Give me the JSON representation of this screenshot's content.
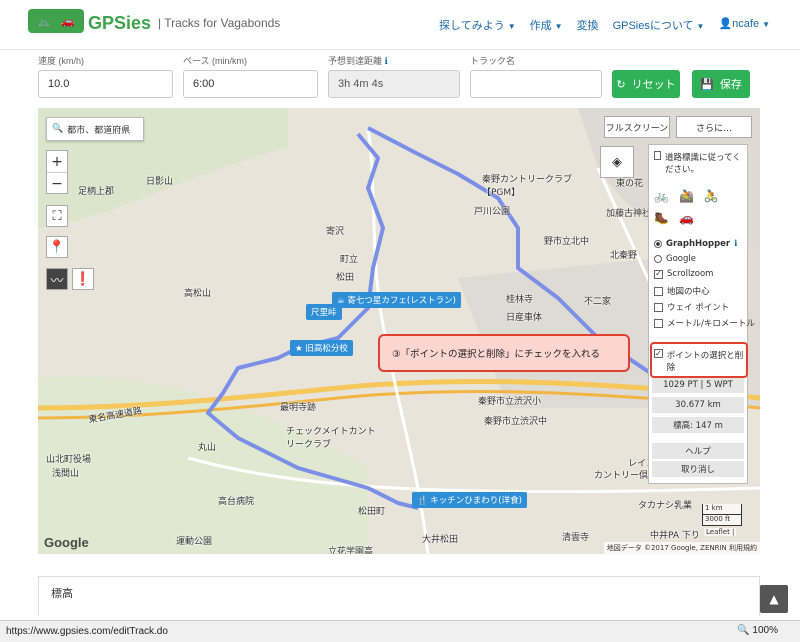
{
  "header": {
    "brand": "GPSies",
    "tagline": "| Tracks for Vagabonds",
    "menu": [
      "探してみよう",
      "作成",
      "変換",
      "GPSiesについて",
      "ncafe"
    ]
  },
  "fields": {
    "speed": {
      "label": "速度 (km/h)",
      "value": "10.0"
    },
    "pace": {
      "label": "ペース (min/km)",
      "value": "6:00"
    },
    "eta": {
      "label": "予想到達距離",
      "value": "3h 4m 4s"
    },
    "track_name": {
      "label": "トラック名",
      "value": ""
    },
    "reset": "リセット",
    "save": "保存"
  },
  "map": {
    "search_placeholder": "都市、都道府県",
    "fullscreen": "フルスクリーン",
    "more": "さらに…",
    "labels": [
      "足柄上郡",
      "日影山",
      "寄沢",
      "町立",
      "松田",
      "高松山",
      "秦野カントリークラブ【PGM】",
      "戸川公園",
      "東の花",
      "加藤古神社",
      "野市立北中",
      "北秦野",
      "桂林寺",
      "不二家",
      "日産車体",
      "最明寺跡",
      "秦野市立渋沢小",
      "秦野市立渋沢中",
      "チェックメイトカントリークラブ",
      "東名高速道路",
      "山北町役場",
      "浅間山",
      "丸山",
      "高台病院",
      "運動公園",
      "松田町",
      "大井松田",
      "立花学園高",
      "清雲寺",
      "カントリー倶楽",
      "レインボー",
      "タカナシ乳業",
      "中井PA 下り"
    ],
    "markers": [
      "寄七つ星カフェ(レストラン)",
      "尺里峠",
      "旧高松分校",
      "キッチンひまわり(洋食)"
    ],
    "google": "Google",
    "attribution": "地図データ ©2017 Google, ZENRIN 利用規約",
    "scale_km": "1 km",
    "scale_ft": "3000 ft",
    "leaflet": "Leaflet |"
  },
  "panel": {
    "follow_roads": "道路標識に従ってください。",
    "graphhopper": "GraphHopper",
    "google": "Google",
    "scrollzoom": "Scrollzoom",
    "map_center": "地図の中心",
    "waypoint": "ウェイ ポイント",
    "meter": "メートル/キロメートル",
    "points": "ポイントの選択と削除",
    "summary": "1029 PT | 5 WPT",
    "distance": "30.677 km",
    "altitude": "標高: 147 m",
    "help": "ヘルプ",
    "cancel": "取り消し"
  },
  "callout": "③「ポイントの選択と削除」にチェックを入れる",
  "elevation_title": "標高",
  "status": {
    "url": "https://www.gpsies.com/editTrack.do",
    "zoom": "100%"
  },
  "colors": {
    "green": "#2fb157",
    "route": "#7b8fe6",
    "callout_border": "#e04030"
  }
}
